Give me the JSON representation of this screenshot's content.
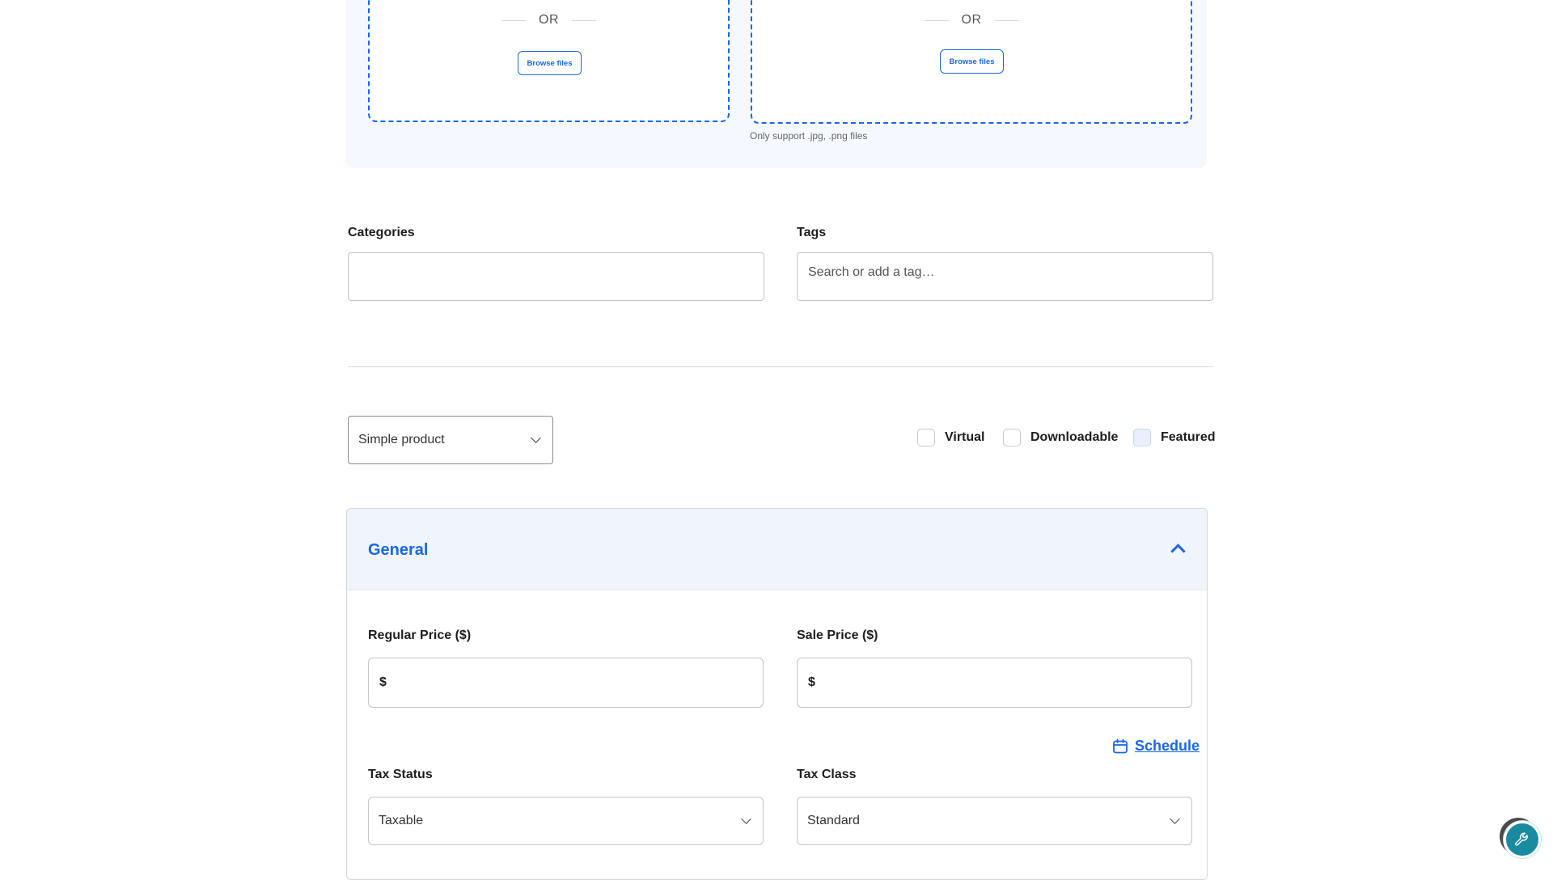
{
  "upload": {
    "left": {
      "or_text": "OR",
      "browse_label": "Browse files"
    },
    "right": {
      "or_text": "OR",
      "browse_label": "Browse files",
      "support_note": "Only support .jpg, .png files"
    }
  },
  "categories": {
    "label": "Categories",
    "value": ""
  },
  "tags": {
    "label": "Tags",
    "placeholder": "Search or add a tag…"
  },
  "product_type": {
    "selected": "Simple product"
  },
  "options": {
    "virtual": {
      "label": "Virtual",
      "checked": false
    },
    "downloadable": {
      "label": "Downloadable",
      "checked": false
    },
    "featured": {
      "label": "Featured",
      "checked": false
    }
  },
  "general": {
    "title": "General",
    "regular_price": {
      "label": "Regular Price ($)",
      "prefix": "$",
      "value": ""
    },
    "sale_price": {
      "label": "Sale Price ($)",
      "prefix": "$",
      "value": ""
    },
    "schedule_label": "Schedule",
    "tax_status": {
      "label": "Tax Status",
      "selected": "Taxable"
    },
    "tax_class": {
      "label": "Tax Class",
      "selected": "Standard"
    }
  },
  "colors": {
    "accent": "#1a66e6",
    "panel_bg": "#f5f9ff",
    "header_bg": "#f0f4fb",
    "fab": "#1a8aa0"
  },
  "icons": [
    "chevron-down-icon",
    "chevron-up-icon",
    "calendar-icon",
    "wrench-icon"
  ]
}
